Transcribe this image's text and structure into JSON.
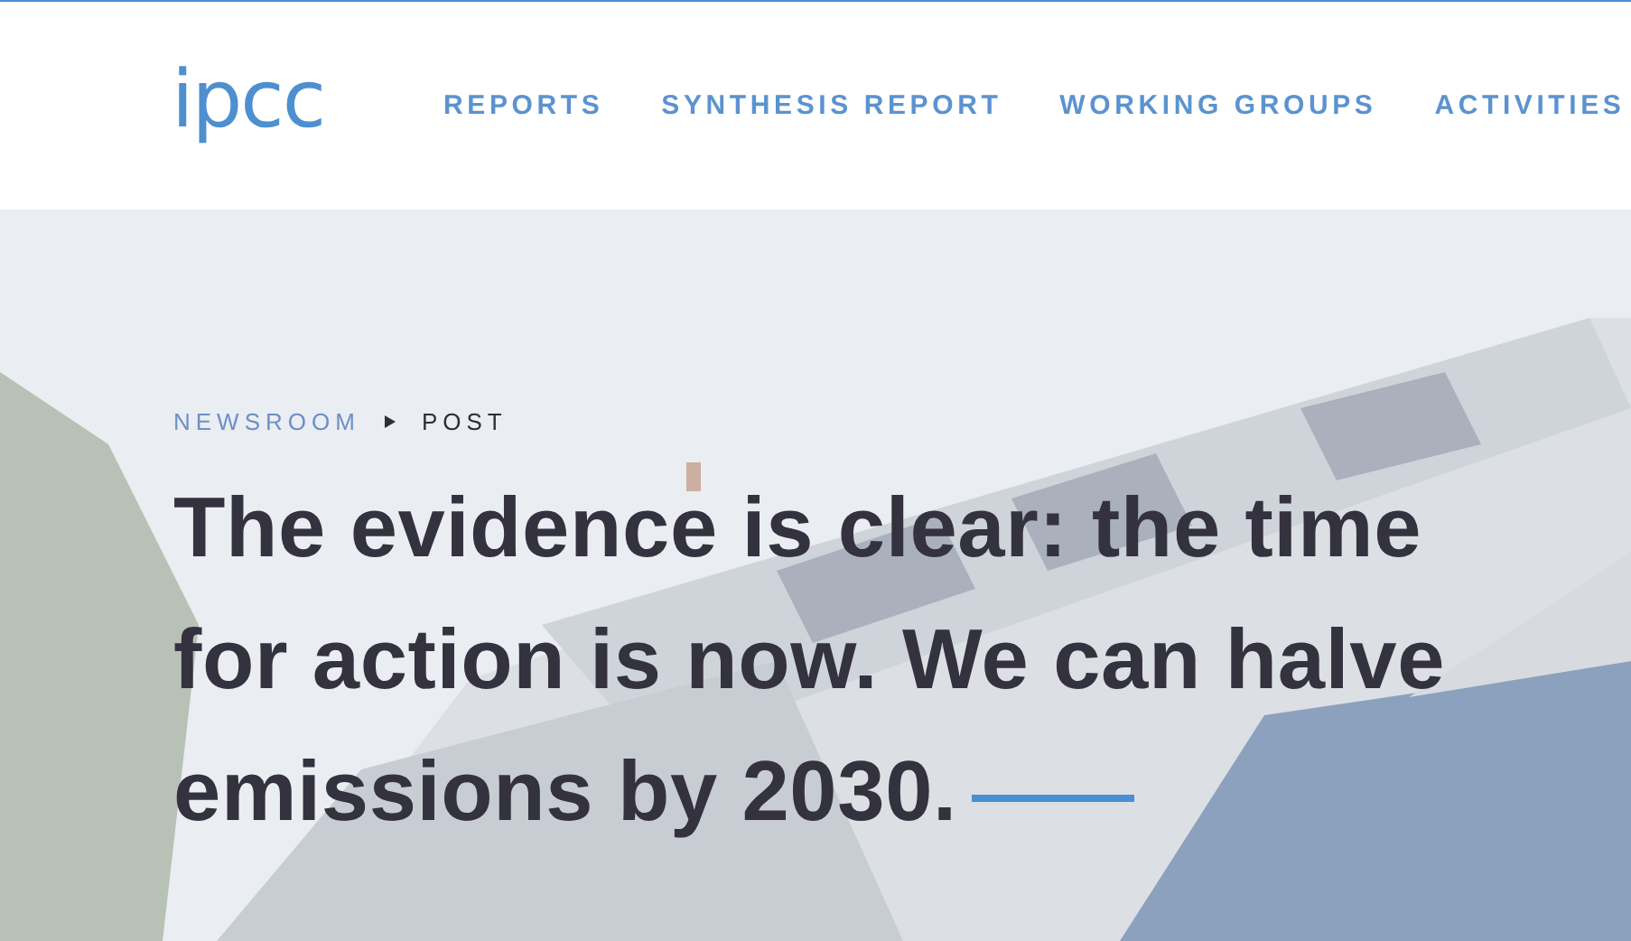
{
  "header": {
    "logo": "ipcc",
    "nav": [
      {
        "label": "REPORTS"
      },
      {
        "label": "SYNTHESIS REPORT"
      },
      {
        "label": "WORKING GROUPS"
      },
      {
        "label": "ACTIVITIES"
      }
    ]
  },
  "hero": {
    "breadcrumb": [
      {
        "label": "NEWSROOM",
        "kind": "link"
      },
      {
        "label": "POST",
        "kind": "current"
      }
    ],
    "headline": "The evidence is clear: the time for action is now. We can halve emissions by 2030."
  }
}
